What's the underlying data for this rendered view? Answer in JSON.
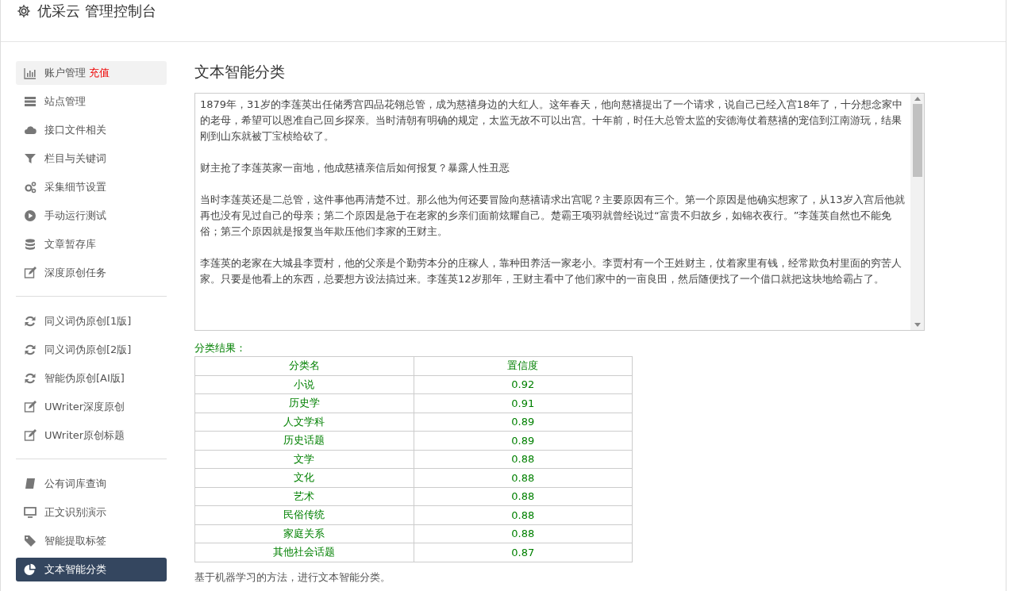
{
  "header": {
    "title": "优采云 管理控制台"
  },
  "sidebar": {
    "groups": [
      {
        "items": [
          {
            "label": "账户管理",
            "badge": "充值",
            "selected": false,
            "highlighted": true
          },
          {
            "label": "站点管理",
            "selected": false,
            "highlighted": false
          },
          {
            "label": "接口文件相关",
            "selected": false,
            "highlighted": false
          },
          {
            "label": "栏目与关键词",
            "selected": false,
            "highlighted": false
          },
          {
            "label": "采集细节设置",
            "selected": false,
            "highlighted": false
          },
          {
            "label": "手动运行测试",
            "selected": false,
            "highlighted": false
          },
          {
            "label": "文章暂存库",
            "selected": false,
            "highlighted": false
          },
          {
            "label": "深度原创任务",
            "selected": false,
            "highlighted": false
          }
        ]
      },
      {
        "items": [
          {
            "label": "同义词伪原创[1版]",
            "selected": false,
            "highlighted": false
          },
          {
            "label": "同义词伪原创[2版]",
            "selected": false,
            "highlighted": false
          },
          {
            "label": "智能伪原创[AI版]",
            "selected": false,
            "highlighted": false
          },
          {
            "label": "UWriter深度原创",
            "selected": false,
            "highlighted": false
          },
          {
            "label": "UWriter原创标题",
            "selected": false,
            "highlighted": false
          }
        ]
      },
      {
        "items": [
          {
            "label": "公有词库查询",
            "selected": false,
            "highlighted": false
          },
          {
            "label": "正文识别演示",
            "selected": false,
            "highlighted": false
          },
          {
            "label": "智能提取标签",
            "selected": false,
            "highlighted": false
          },
          {
            "label": "文本智能分类",
            "selected": true,
            "highlighted": false
          }
        ]
      }
    ]
  },
  "main": {
    "title": "文本智能分类",
    "input_text": [
      "1879年，31岁的李莲英出任储秀宫四品花翎总管，成为慈禧身边的大红人。这年春天，他向慈禧提出了一个请求，说自己已经入宫18年了，十分想念家中的老母，希望可以恩准自己回乡探亲。当时清朝有明确的规定，太监无故不可以出宫。十年前，时任大总管太监的安德海仗着慈禧的宠信到江南游玩，结果刚到山东就被丁宝桢给砍了。",
      "财主抢了李莲英家一亩地，他成慈禧亲信后如何报复？暴露人性丑恶",
      "当时李莲英还是二总管，这件事他再清楚不过。那么他为何还要冒险向慈禧请求出宫呢？主要原因有三个。第一个原因是他确实想家了，从13岁入宫后他就再也没有见过自己的母亲；第二个原因是急于在老家的乡亲们面前炫耀自己。楚霸王项羽就曾经说过“富贵不归故乡，如锦衣夜行。”李莲英自然也不能免俗；第三个原因就是报复当年欺压他们李家的王财主。",
      "李莲英的老家在大城县李贾村，他的父亲是个勤劳本分的庄稼人，靠种田养活一家老小。李贾村有一个王姓财主，仗着家里有钱，经常欺负村里面的穷苦人家。只要是他看上的东西，总要想方设法搞过来。李莲英12岁那年，王财主看中了他们家中的一亩良田，然后随便找了一个借口就把这块地给霸占了。"
    ],
    "result_label": "分类结果：",
    "table": {
      "columns": [
        "分类名",
        "置信度"
      ],
      "rows": [
        [
          "小说",
          "0.92"
        ],
        [
          "历史学",
          "0.91"
        ],
        [
          "人文学科",
          "0.89"
        ],
        [
          "历史话题",
          "0.89"
        ],
        [
          "文学",
          "0.88"
        ],
        [
          "文化",
          "0.88"
        ],
        [
          "艺术",
          "0.88"
        ],
        [
          "民俗传统",
          "0.88"
        ],
        [
          "家庭关系",
          "0.88"
        ],
        [
          "其他社会话题",
          "0.87"
        ]
      ]
    },
    "description": "基于机器学习的方法，进行文本智能分类。"
  }
}
